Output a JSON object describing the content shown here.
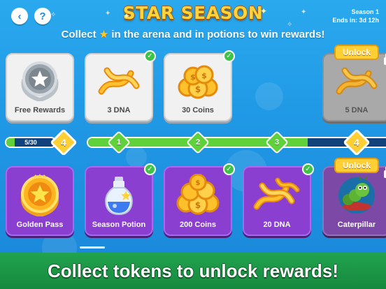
{
  "header": {
    "back_icon": "chevron-left-icon",
    "help_label": "?",
    "title": "STAR SEASON",
    "season_label": "Season 1",
    "ends_label": "Ends in: 3d 12h",
    "subtitle_before": "Collect",
    "subtitle_icon": "star-icon",
    "subtitle_after": "in the arena and in potions to win rewards!"
  },
  "free_track": {
    "cards": [
      {
        "label": "Free Rewards",
        "icon": "medal-star-icon",
        "claimed": false
      },
      {
        "label": "3 DNA",
        "icon": "dna-icon",
        "claimed": true
      },
      {
        "label": "30 Coins",
        "icon": "coins-icon",
        "claimed": true
      },
      {
        "label": "5 DNA",
        "icon": "dna-icon",
        "claimed": false,
        "badge": "Unlock",
        "locked": true
      }
    ]
  },
  "golden_track": {
    "cards": [
      {
        "label": "Golden Pass",
        "icon": "golden-star-badge-icon",
        "claimed": false
      },
      {
        "label": "Season Potion",
        "icon": "potion-icon",
        "claimed": true
      },
      {
        "label": "200 Coins",
        "icon": "coins-icon",
        "claimed": true
      },
      {
        "label": "20 DNA",
        "icon": "dna-icon",
        "claimed": true
      },
      {
        "label": "Caterpillar",
        "icon": "caterpillar-icon",
        "claimed": false,
        "badge": "Unlock",
        "locked": true
      }
    ]
  },
  "progress": {
    "tokens_text": "5/30",
    "tokens_fraction": 0.1667,
    "current_level": "4",
    "main_fill_fraction": 0.72,
    "milestones": [
      "1",
      "2",
      "3"
    ],
    "next_level": "4"
  },
  "footer": {
    "banner_text": "Collect tokens to unlock rewards!"
  },
  "colors": {
    "sky": "#2aa9ee",
    "title_gold": "#ffd43a",
    "progress_green": "#5fd13b",
    "track_navy": "#12427c",
    "golden_purple": "#8a3fd0",
    "banner_green": "#21a34e",
    "unlock_gold": "#ffcf33"
  }
}
